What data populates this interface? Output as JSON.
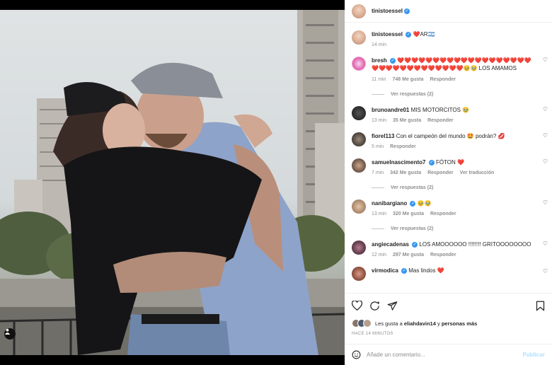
{
  "header": {
    "username": "tinistoessel"
  },
  "caption": {
    "username": "tinistoessel",
    "text": "❤️AR🇦🇷",
    "time": "14 min"
  },
  "comments": [
    {
      "username": "bresh",
      "verified": true,
      "text": "❤️❤️❤️❤️❤️❤️❤️❤️❤️❤️❤️❤️❤️❤️❤️❤️❤️❤️❤️❤️❤️❤️❤️❤️❤️❤️❤️❤️❤️❤️❤️❤️🥹🥹 LOS AMAMOS",
      "time": "11 min",
      "likes": "748 Me gusta",
      "reply": "Responder",
      "replies": "Ver respuestas (2)"
    },
    {
      "username": "bruno­andre01",
      "verified": false,
      "text": "MIS MOTORCITOS 🥹",
      "time": "13 min",
      "likes": "35 Me gusta",
      "reply": "Responder"
    },
    {
      "username": "fiorel113",
      "verified": false,
      "text": "Con el campeón del mundo 🤩 podrán? 💋",
      "time": "5 min",
      "reply": "Responder"
    },
    {
      "username": "samuelnascimento7",
      "verified": true,
      "text": "FÓTON ❤️",
      "time": "7 min",
      "likes": "342 Me gusta",
      "reply": "Responder",
      "translate": "Ver traducción",
      "replies": "Ver respuestas (2)"
    },
    {
      "username": "nanibargiano",
      "verified": true,
      "text": "🥹🥹",
      "time": "13 min",
      "likes": "320 Me gusta",
      "reply": "Responder",
      "replies": "Ver respuestas (2)"
    },
    {
      "username": "angiecadenas",
      "verified": true,
      "text": "LOS AMOOOOOO !!!!!!!! GRITOOOOOOOO",
      "time": "12 min",
      "likes": "297 Me gusta",
      "reply": "Responder"
    },
    {
      "username": "virmodica",
      "verified": true,
      "text": "Mas lindos ❤️"
    }
  ],
  "likes_line": {
    "prefix": "Les gusta a",
    "user": "eliahdavin14",
    "middle": "y",
    "others": "personas más"
  },
  "time_ago": "HACE 14 MINUTOS",
  "composer": {
    "placeholder": "Añade un comentario...",
    "publish": "Publicar"
  },
  "colors": {
    "accent": "#3897f0",
    "heart": "#ed4956",
    "publish": "#b2dffc"
  }
}
